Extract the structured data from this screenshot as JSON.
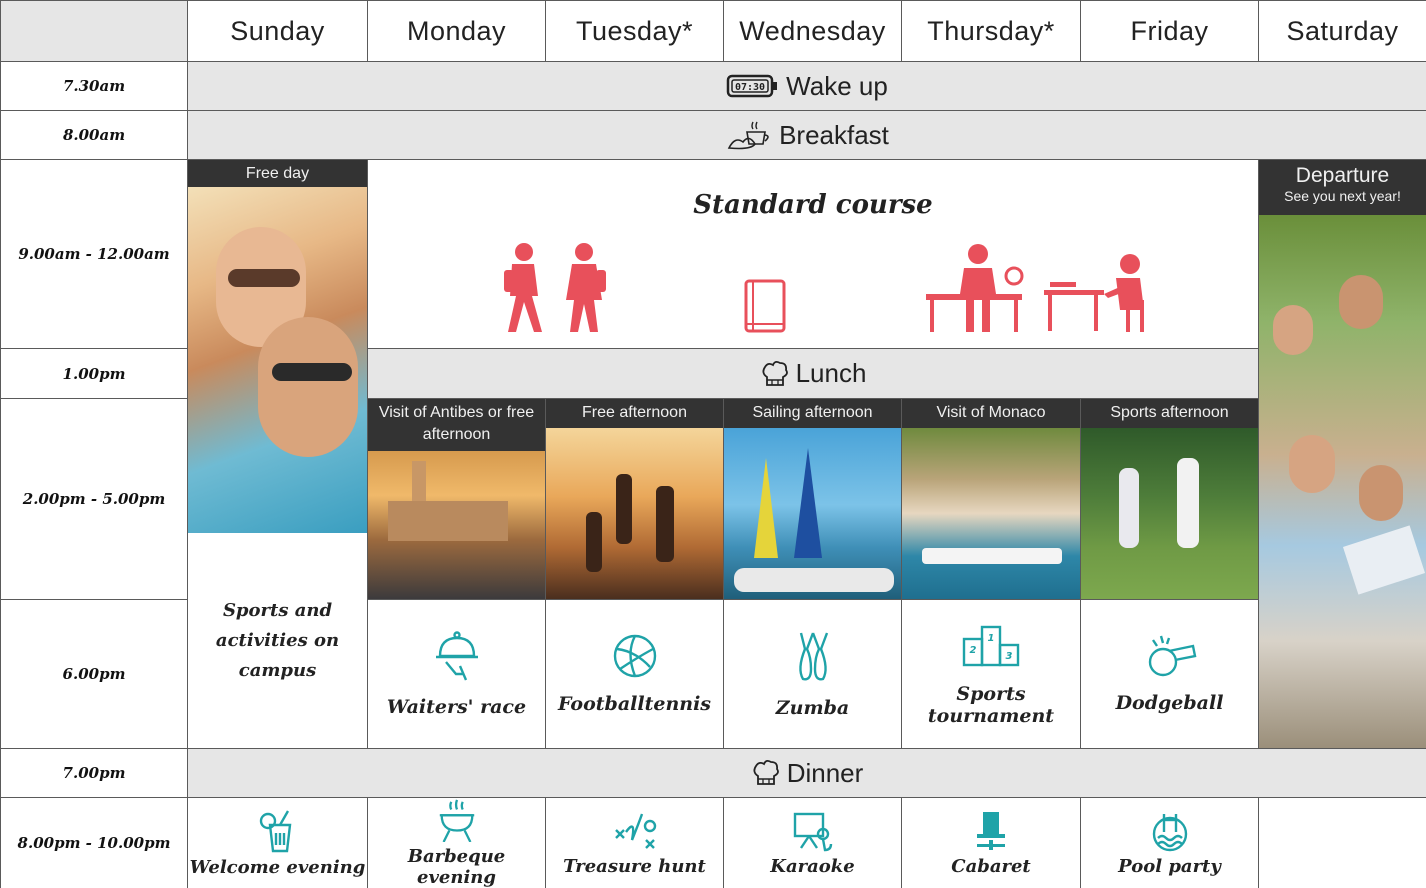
{
  "days": [
    "Sunday",
    "Monday",
    "Tuesday*",
    "Wednesday",
    "Thursday*",
    "Friday",
    "Saturday"
  ],
  "times": [
    "7.30am",
    "8.00am",
    "9.00am - 12.00am",
    "1.00pm",
    "2.00pm - 5.00pm",
    "6.00pm",
    "7.00pm",
    "8.00pm - 10.00pm"
  ],
  "banners": {
    "wake": "Wake up",
    "breakfast": "Breakfast",
    "lunch": "Lunch",
    "dinner": "Dinner",
    "clock": "07:30"
  },
  "sunday": {
    "caption": "Free day",
    "campus": "Sports and activities on campus"
  },
  "saturday": {
    "title": "Departure",
    "subtitle": "See you next year!"
  },
  "course": "Standard course",
  "afternoons": [
    "Visit of Antibes or free afternoon",
    "Free afternoon",
    "Sailing afternoon",
    "Visit of Monaco",
    "Sports afternoon"
  ],
  "activities": [
    "Waiters' race",
    "Footballtennis",
    "Zumba",
    "Sports tournament",
    "Dodgeball"
  ],
  "evenings": [
    "Welcome evening",
    "Barbeque evening",
    "Treasure hunt",
    "Karaoke",
    "Cabaret",
    "Pool party"
  ],
  "colors": {
    "accent_red": "#e8505b",
    "accent_teal": "#1fa3a8",
    "banner_gray": "#e6e6e6",
    "caption_dark": "#333333"
  }
}
